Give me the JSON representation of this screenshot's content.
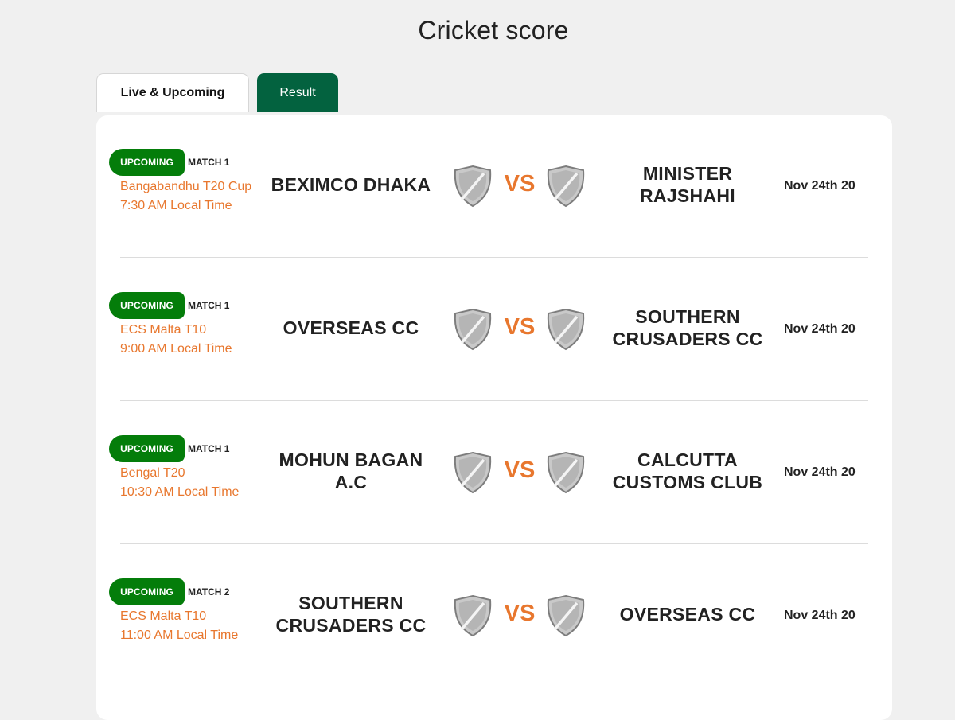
{
  "page": {
    "title": "Cricket score"
  },
  "tabs": [
    {
      "label": "Live & Upcoming",
      "active": true
    },
    {
      "label": "Result",
      "active": false
    }
  ],
  "colors": {
    "accent_orange": "#e8772e",
    "badge_green": "#047d0a",
    "tab_green": "#03623f"
  },
  "matches": [
    {
      "status": "UPCOMING",
      "match_no": "MATCH 1",
      "league": "Bangabandhu T20 Cup",
      "time": "7:30 AM Local Time",
      "team_a": "BEXIMCO DHAKA",
      "team_b": "MINISTER RAJSHAHI",
      "vs": "VS",
      "date": "Nov 24th 20",
      "team_a_icon": "shield-icon",
      "team_b_icon": "shield-icon"
    },
    {
      "status": "UPCOMING",
      "match_no": "MATCH 1",
      "league": "ECS Malta T10",
      "time": "9:00 AM Local Time",
      "team_a": "OVERSEAS CC",
      "team_b": "SOUTHERN CRUSADERS CC",
      "vs": "VS",
      "date": "Nov 24th 20",
      "team_a_icon": "shield-icon",
      "team_b_icon": "shield-icon"
    },
    {
      "status": "UPCOMING",
      "match_no": "MATCH 1",
      "league": "Bengal T20",
      "time": "10:30 AM Local Time",
      "team_a": "MOHUN BAGAN A.C",
      "team_b": "CALCUTTA CUSTOMS CLUB",
      "vs": "VS",
      "date": "Nov 24th 20",
      "team_a_icon": "shield-icon",
      "team_b_icon": "shield-icon"
    },
    {
      "status": "UPCOMING",
      "match_no": "MATCH 2",
      "league": "ECS Malta T10",
      "time": "11:00 AM Local Time",
      "team_a": "SOUTHERN CRUSADERS CC",
      "team_b": "OVERSEAS CC",
      "vs": "VS",
      "date": "Nov 24th 20",
      "team_a_icon": "shield-icon",
      "team_b_icon": "shield-icon"
    }
  ]
}
